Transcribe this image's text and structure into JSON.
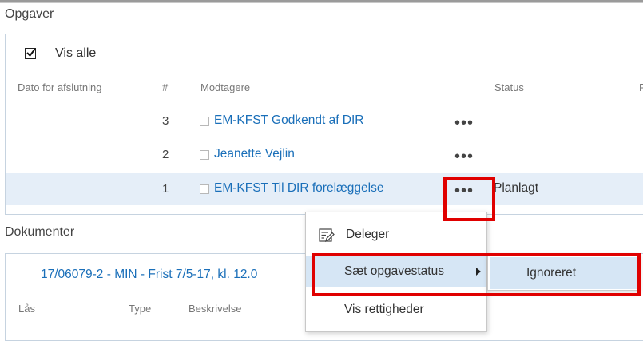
{
  "tasks": {
    "section_title": "Opgaver",
    "show_all_label": "Vis alle",
    "columns": [
      "Dato for afslutning",
      "#",
      "Modtagere",
      "Status",
      "F"
    ],
    "rows": [
      {
        "number": "3",
        "recipient": "EM-KFST Godkendt af DIR",
        "more": "•••",
        "status": ""
      },
      {
        "number": "2",
        "recipient": "Jeanette Vejlin",
        "more": "•••",
        "status": ""
      },
      {
        "number": "1",
        "recipient": "EM-KFST Til DIR forelæggelse",
        "more": "•••",
        "status": "Planlagt"
      }
    ]
  },
  "documents": {
    "section_title": "Dokumenter",
    "document_link": "17/06079-2 - MIN - Frist 7/5-17, kl. 12.0",
    "columns": [
      "Lås",
      "Type",
      "Beskrivelse"
    ]
  },
  "context_menu": {
    "items": [
      {
        "label": "Deleger",
        "icon": "edit-list-icon"
      },
      {
        "label": "Sæt opgavestatus",
        "has_submenu": true
      },
      {
        "label": "Vis rettigheder"
      }
    ],
    "submenu": {
      "items": [
        {
          "label": "Ignoreret"
        }
      ]
    }
  },
  "colors": {
    "link": "#1a6fb9",
    "highlight": "#e5eef8",
    "annotation": "#e00000"
  }
}
